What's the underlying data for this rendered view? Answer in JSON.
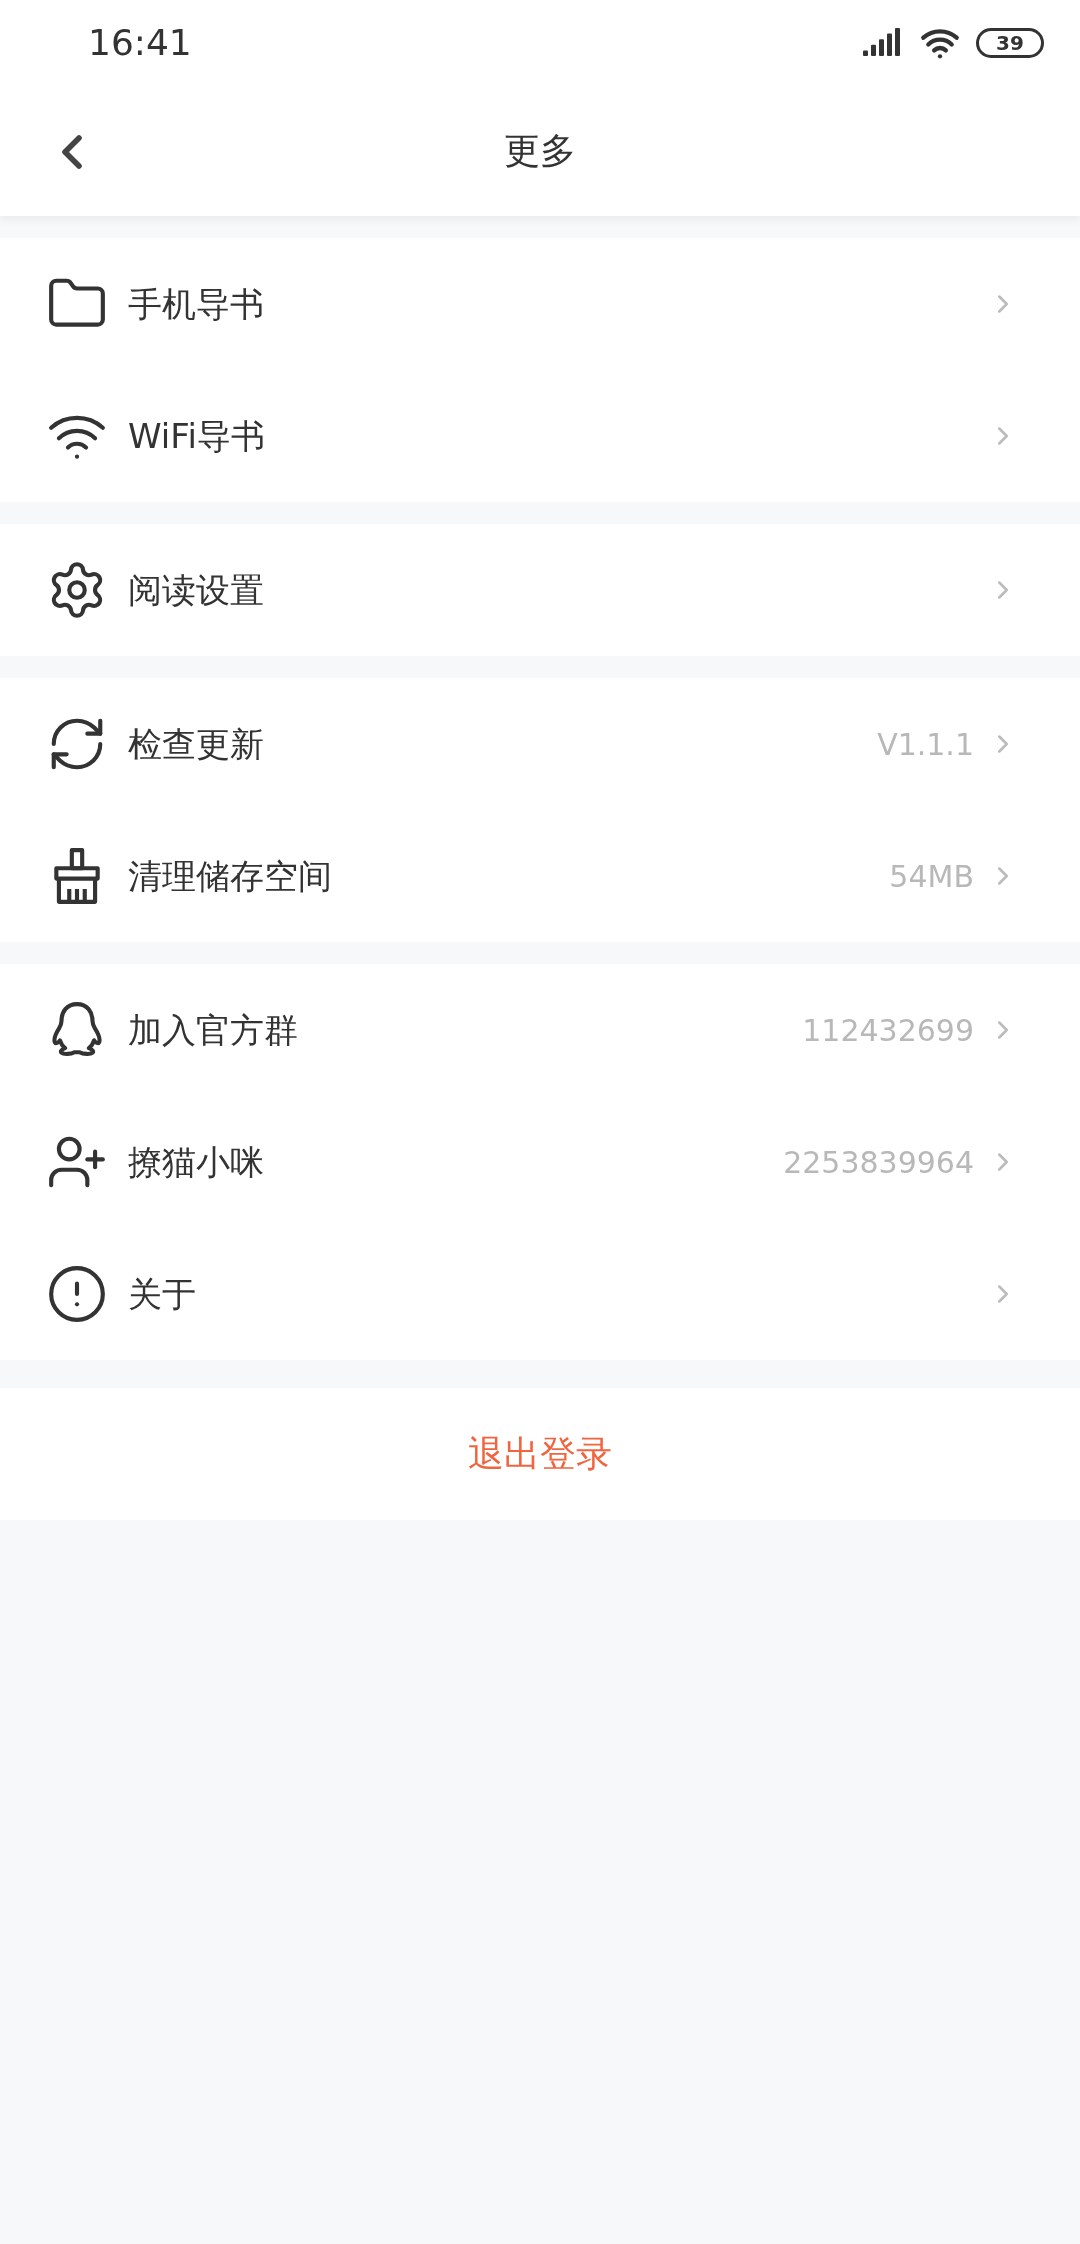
{
  "status_bar": {
    "time": "16:41",
    "battery": "39"
  },
  "header": {
    "title": "更多"
  },
  "groups": [
    {
      "items": [
        {
          "label": "手机导书"
        },
        {
          "label": "WiFi导书"
        }
      ]
    },
    {
      "items": [
        {
          "label": "阅读设置"
        }
      ]
    },
    {
      "items": [
        {
          "label": "检查更新",
          "value": "V1.1.1"
        },
        {
          "label": "清理储存空间",
          "value": "54MB"
        }
      ]
    },
    {
      "items": [
        {
          "label": "加入官方群",
          "value": "112432699"
        },
        {
          "label": "撩猫小咪",
          "value": "2253839964"
        },
        {
          "label": "关于"
        }
      ]
    }
  ],
  "logout": {
    "label": "退出登录"
  }
}
